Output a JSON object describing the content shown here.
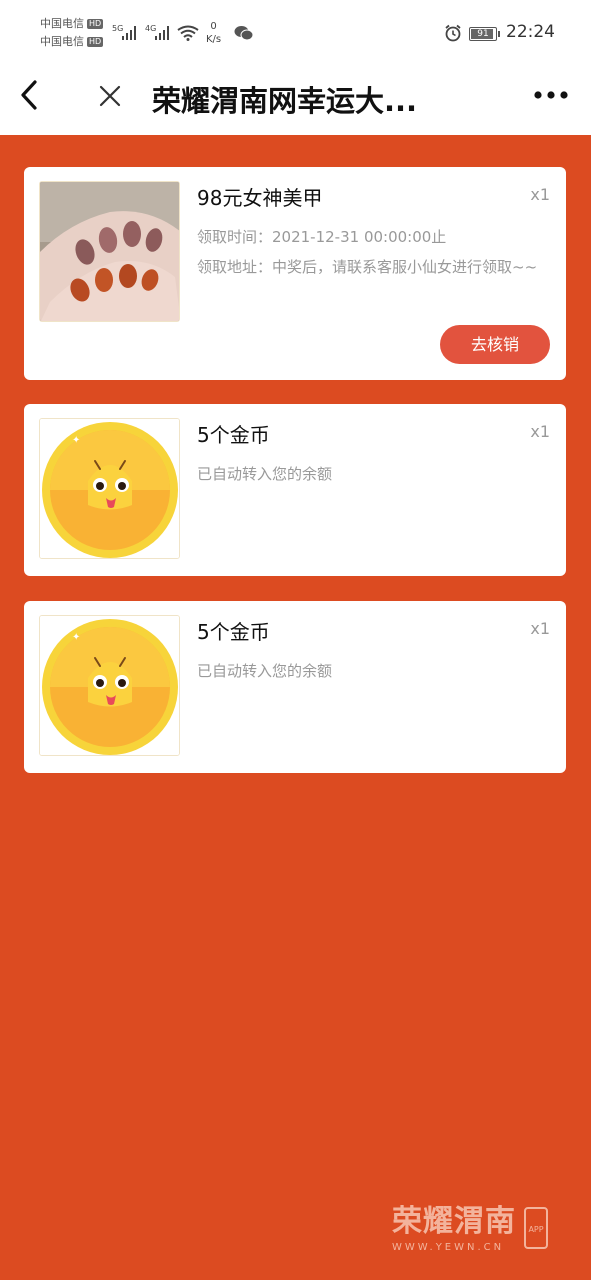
{
  "status_bar": {
    "carrier1": "中国电信",
    "carrier2": "中国电信",
    "hd": "HD",
    "net1": "5G",
    "net2": "4G",
    "speed_value": "0",
    "speed_unit": "K/s",
    "battery": "91",
    "time": "22:24"
  },
  "nav": {
    "title": "荣耀渭南网幸运大..."
  },
  "prizes": [
    {
      "title": "98元女神美甲",
      "qty": "x1",
      "time_line": "领取时间：2021-12-31 00:00:00止",
      "address_line": "领取地址：中奖后，请联系客服小仙女进行领取~~",
      "action_label": "去核销"
    },
    {
      "title": "5个金币",
      "qty": "x1",
      "note": "已自动转入您的余额"
    },
    {
      "title": "5个金币",
      "qty": "x1",
      "note": "已自动转入您的余额"
    }
  ],
  "watermark": {
    "brand": "荣耀渭南",
    "url": "WWW.YEWN.CN",
    "app": "APP"
  },
  "colors": {
    "page_bg": "#dc4b21",
    "button": "#e2533e"
  },
  "icons": [
    "back-icon",
    "close-icon",
    "more-icon",
    "wifi-icon",
    "wechat-icon",
    "alarm-icon"
  ]
}
